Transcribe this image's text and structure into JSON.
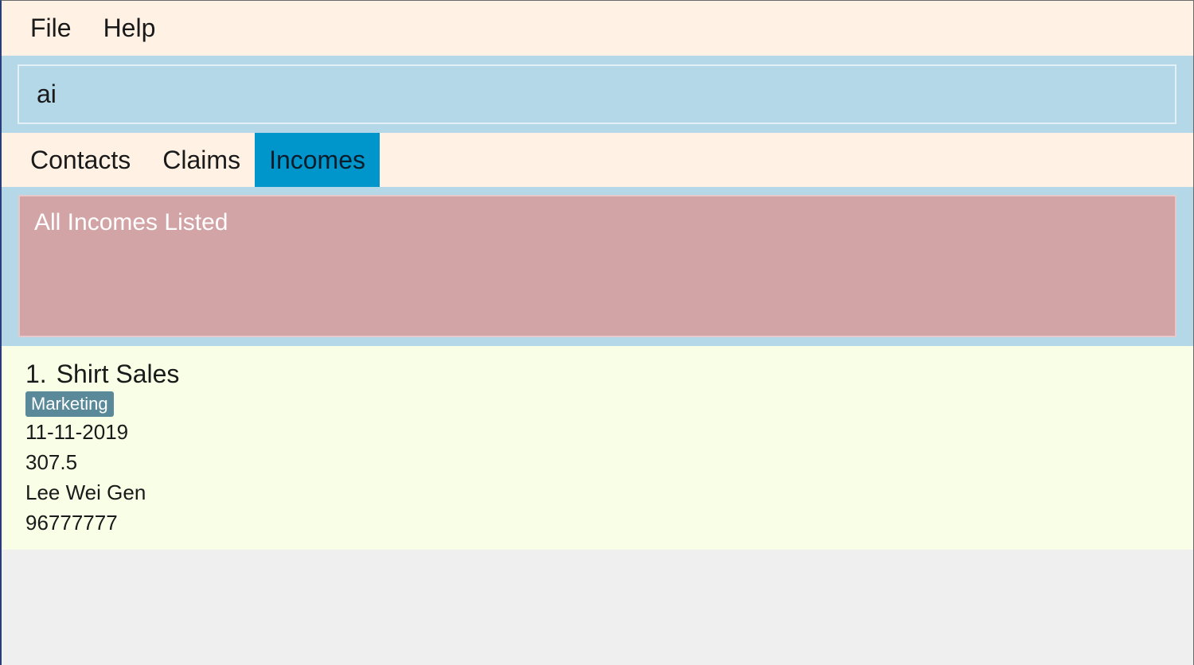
{
  "menu": {
    "items": [
      {
        "label": "File"
      },
      {
        "label": "Help"
      }
    ]
  },
  "command": {
    "value": "ai"
  },
  "tabs": {
    "items": [
      {
        "label": "Contacts",
        "active": false
      },
      {
        "label": "Claims",
        "active": false
      },
      {
        "label": "Incomes",
        "active": true
      }
    ]
  },
  "result": {
    "message": "All Incomes Listed"
  },
  "incomes": [
    {
      "index": "1.",
      "description": "Shirt Sales",
      "tag": "Marketing",
      "date": "11-11-2019",
      "amount": "307.5",
      "name": "Lee Wei Gen",
      "phone": "96777777"
    }
  ],
  "colors": {
    "menubar": "#fff1e4",
    "command_area": "#b4d8e8",
    "active_tab": "#0096cc",
    "result_box": "#d3a4a6",
    "list_bg": "#f8ffe6",
    "tag": "#5a8a99"
  }
}
